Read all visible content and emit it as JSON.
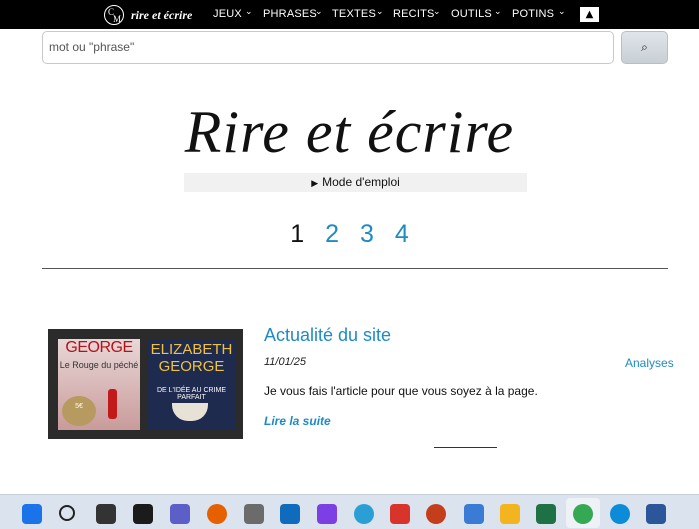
{
  "nav": {
    "logo_letters": [
      "C",
      "M"
    ],
    "brand": "rire et écrire",
    "items": [
      {
        "label": "JEUX",
        "chevron": "⌄"
      },
      {
        "label": "PHRASES",
        "chevron": "⌄"
      },
      {
        "label": "TEXTES",
        "chevron": "⌄"
      },
      {
        "label": "RECITS",
        "chevron": "⌄"
      },
      {
        "label": "OUTILS",
        "chevron": "⌄"
      },
      {
        "label": "POTINS",
        "chevron": "⌄"
      }
    ],
    "scroll_top_symbol": "▲"
  },
  "search": {
    "placeholder": "mot ou \"phrase\"",
    "button_icon": "search-icon",
    "button_symbol": "⌕"
  },
  "hero": {
    "title": "Rire et écrire",
    "mode_label": "Mode d'emploi",
    "mode_triangle": "▶"
  },
  "pagination": {
    "current": "1",
    "pages": [
      "2",
      "3",
      "4"
    ]
  },
  "article": {
    "title": "Actualité du site",
    "date": "11/01/25",
    "category": "Analyses",
    "excerpt": "Je vous fais l'article pour que vous soyez à la page.",
    "read_more": "Lire la suite",
    "thumbnail": {
      "book1_author": "GEORGE",
      "book1_title": "Le Rouge du péché",
      "book1_badge": "5€",
      "book2_author": "ELIZABETH GEORGE",
      "book2_title": "DE L'IDÉE AU CRIME PARFAIT"
    }
  },
  "taskbar": {
    "icons": [
      {
        "name": "windows-start-icon",
        "color": "#1a73e8"
      },
      {
        "name": "search-icon",
        "color": "#222222"
      },
      {
        "name": "task-view-icon",
        "color": "#333333"
      },
      {
        "name": "terminal-icon",
        "color": "#1b1b1b"
      },
      {
        "name": "teams-icon",
        "color": "#5b5fc7"
      },
      {
        "name": "firefox-icon",
        "color": "#e66000"
      },
      {
        "name": "printer-icon",
        "color": "#6b6b6b"
      },
      {
        "name": "outlook-calendar-icon",
        "color": "#0f6cbd"
      },
      {
        "name": "m365-icon",
        "color": "#7b3fe4"
      },
      {
        "name": "paint-icon",
        "color": "#2a9fd6"
      },
      {
        "name": "snipping-tool-icon",
        "color": "#d9342b"
      },
      {
        "name": "powerpoint-icon",
        "color": "#c43e1c"
      },
      {
        "name": "notepad-icon",
        "color": "#3a7bd5"
      },
      {
        "name": "file-explorer-icon",
        "color": "#f2b51f"
      },
      {
        "name": "excel-icon",
        "color": "#1e7145"
      },
      {
        "name": "chrome-icon",
        "color": "#34a853"
      },
      {
        "name": "edge-icon",
        "color": "#0c8cd8"
      },
      {
        "name": "word-icon",
        "color": "#2b579a"
      }
    ]
  }
}
